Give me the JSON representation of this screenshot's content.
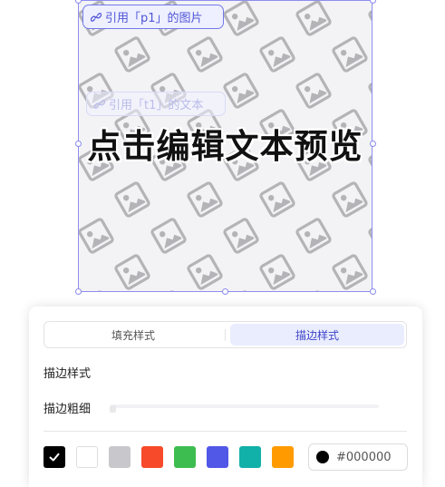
{
  "canvas": {
    "reference_tag": "引用「p1」的图片",
    "reference_tag_faded": "引用「t1」的文本",
    "preview_text": "点击编辑文本预览"
  },
  "panel": {
    "tabs": [
      {
        "label": "填充样式",
        "active": false
      },
      {
        "label": "描边样式",
        "active": true
      }
    ],
    "section_title": "描边样式",
    "stroke_width_label": "描边粗细",
    "stroke_width_value": 0,
    "colors": [
      {
        "name": "black",
        "hex": "#000000",
        "selected": true
      },
      {
        "name": "white",
        "hex": "#ffffff",
        "selected": false
      },
      {
        "name": "gray",
        "hex": "#c8c8cc",
        "selected": false
      },
      {
        "name": "red",
        "hex": "#f64a2a",
        "selected": false
      },
      {
        "name": "green",
        "hex": "#3dbd50",
        "selected": false
      },
      {
        "name": "indigo",
        "hex": "#5157e6",
        "selected": false
      },
      {
        "name": "teal",
        "hex": "#11b0a8",
        "selected": false
      },
      {
        "name": "orange",
        "hex": "#ff9b00",
        "selected": false
      }
    ],
    "hex_value": "#000000"
  },
  "icons": {
    "link": "link-icon",
    "check": "check-icon",
    "image_placeholder": "image-placeholder-icon"
  },
  "accent": "#5157e6"
}
